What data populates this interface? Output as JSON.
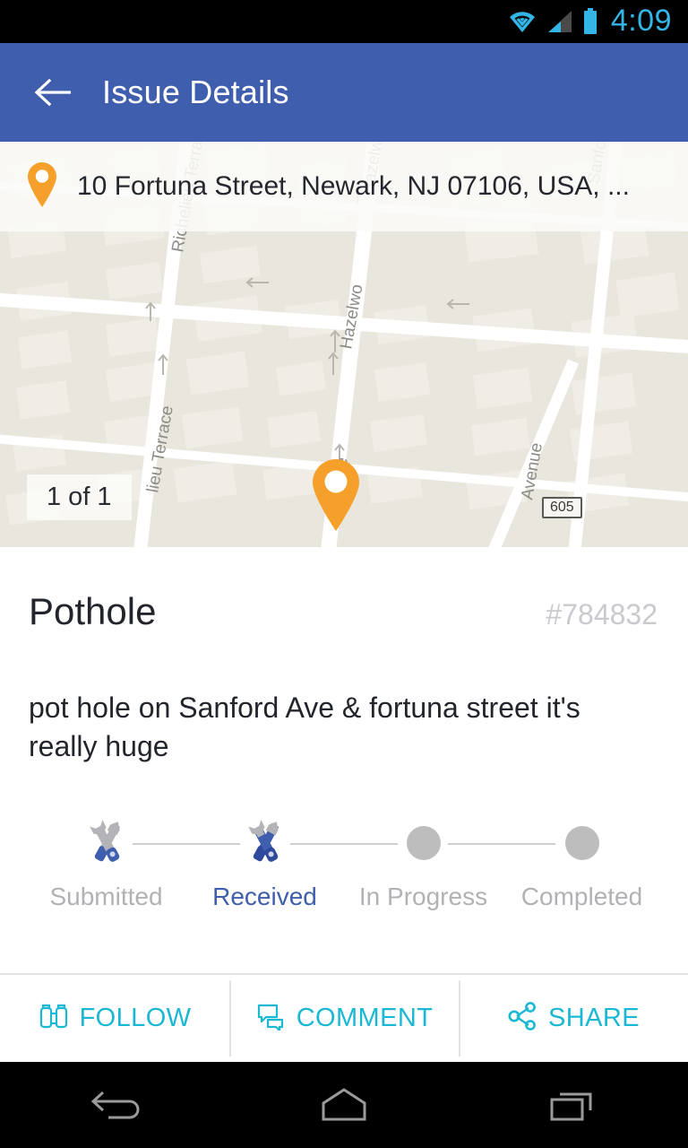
{
  "statusbar": {
    "time": "4:09",
    "icons": [
      "wifi-icon",
      "cell-signal-icon",
      "battery-icon"
    ],
    "accent_color": "#33b5e5",
    "background": "#000000"
  },
  "appbar": {
    "title": "Issue Details",
    "back_icon": "back-arrow-icon",
    "background": "#3f5ead",
    "text_color": "#ffffff"
  },
  "map": {
    "address": "10 Fortuna Street, Newark, NJ 07106, USA, ...",
    "pin_icon": "map-pin-icon",
    "pin_color": "#f5a02a",
    "photo_count": "1 of 1",
    "route_shield": "605",
    "background": "#e9e6dd",
    "street_labels": [
      "Richelieu Terrace",
      "Richelieu Terrace",
      "Hazelwood Ave",
      "Hazelwood Ave",
      "Sanford Ave",
      "Hazelwood Ave",
      "Avenue"
    ]
  },
  "issue": {
    "title": "Pothole",
    "id": "#784832",
    "description": "pot hole on Sanford Ave & fortuna street it's really huge"
  },
  "stepper": {
    "active_color": "#3f5ead",
    "inactive_color": "#b2b2b6",
    "steps": [
      {
        "label": "Submitted",
        "icon": "tools-icon",
        "state": "done"
      },
      {
        "label": "Received",
        "icon": "tools-icon",
        "state": "active"
      },
      {
        "label": "In Progress",
        "icon": "dot-icon",
        "state": "pending"
      },
      {
        "label": "Completed",
        "icon": "dot-icon",
        "state": "pending"
      }
    ]
  },
  "actions": {
    "accent_color": "#1bb8d4",
    "items": [
      {
        "label": "FOLLOW",
        "icon": "binoculars-icon"
      },
      {
        "label": "COMMENT",
        "icon": "comment-bubbles-icon"
      },
      {
        "label": "SHARE",
        "icon": "share-nodes-icon"
      }
    ]
  },
  "navbar": {
    "buttons": [
      "back-nav-icon",
      "home-nav-icon",
      "recents-nav-icon"
    ]
  }
}
